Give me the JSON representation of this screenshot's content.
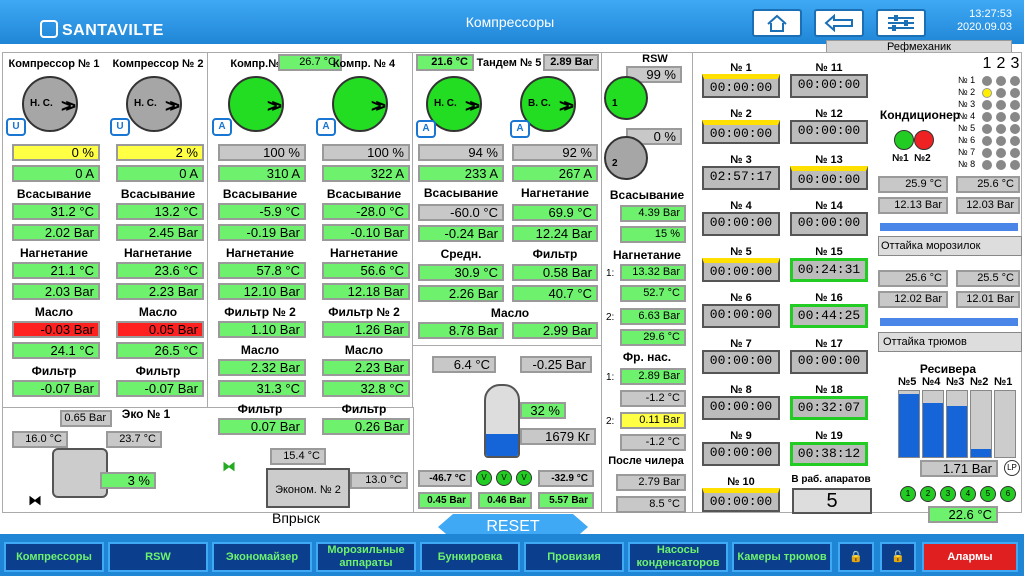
{
  "header": {
    "brand": "SANTAVILTE",
    "title": "Компрессоры",
    "time": "13:27:53",
    "date": "2020.09.03",
    "role": "Рефмеханик"
  },
  "compressors": [
    {
      "title": "Компрессор № 1",
      "mode": "Н. С.",
      "pct": "0 %",
      "amp": "0 A",
      "suction": "Всасывание",
      "s_temp": "31.2 °C",
      "s_bar": "2.02 Bar",
      "disch": "Нагнетание",
      "d_temp": "21.1 °C",
      "d_bar": "2.03 Bar",
      "oil": "Масло",
      "oil_bar": "-0.03 Bar",
      "oil_temp": "24.1 °C",
      "filter": "Фильтр",
      "f_bar": "-0.07 Bar"
    },
    {
      "title": "Компрессор № 2",
      "mode": "Н. С.",
      "pct": "2 %",
      "amp": "0 A",
      "suction": "Всасывание",
      "s_temp": "13.2 °C",
      "s_bar": "2.45 Bar",
      "disch": "Нагнетание",
      "d_temp": "23.6 °C",
      "d_bar": "2.23 Bar",
      "oil": "Масло",
      "oil_bar": "0.05 Bar",
      "oil_temp": "26.5 °C",
      "filter": "Фильтр",
      "f_bar": "-0.07 Bar"
    },
    {
      "title": "Компр.№ 3",
      "top": "26.7 °C",
      "pct": "100 %",
      "amp": "310 A",
      "suction": "Всасывание",
      "s_temp": "-5.9 °C",
      "s_bar": "-0.19 Bar",
      "disch": "Нагнетание",
      "d_temp": "57.8 °C",
      "d_bar": "12.10 Bar",
      "f2": "Фильтр № 2",
      "f2_bar": "1.10 Bar",
      "oil": "Масло",
      "oil_bar": "2.32 Bar",
      "oil_temp": "31.3 °C",
      "filter": "Фильтр",
      "f_bar": "0.07 Bar"
    },
    {
      "title": "Компр. № 4",
      "pct": "100 %",
      "amp": "322 A",
      "suction": "Всасывание",
      "s_temp": "-28.0 °C",
      "s_bar": "-0.10 Bar",
      "disch": "Нагнетание",
      "d_temp": "56.6 °C",
      "d_bar": "12.18 Bar",
      "f2": "Фильтр № 2",
      "f2_bar": "1.26 Bar",
      "oil": "Масло",
      "oil_bar": "2.23 Bar",
      "oil_temp": "32.8 °C",
      "filter": "Фильтр",
      "f_bar": "0.26 Bar"
    }
  ],
  "tandem": {
    "top_temp": "21.6 °C",
    "title": "Тандем № 5",
    "top_bar": "2.89 Bar",
    "mode_a": "Н. С.",
    "mode_b": "В. С.",
    "pct_a": "94 %",
    "pct_b": "92 %",
    "amp_a": "233 A",
    "amp_b": "267 A",
    "suction": "Всасывание",
    "disch": "Нагнетание",
    "s_temp": "-60.0 °C",
    "d_temp": "69.9 °C",
    "s_bar": "-0.24 Bar",
    "d_bar": "12.24 Bar",
    "mid": "Средн.",
    "filt": "Фильтр",
    "mid_temp": "30.9 °C",
    "filt_bar": "0.58 Bar",
    "mid_bar": "2.26 Bar",
    "filt_temp": "40.7 °C",
    "oil": "Масло",
    "oil_a": "8.78 Bar",
    "oil_b": "2.99 Bar"
  },
  "eco": {
    "title": "Эко № 1",
    "p": "0.65 Bar",
    "t1": "16.0 °C",
    "t2": "23.7 °C",
    "pct": "3 %",
    "t3": "15.4 °C",
    "econ": "Эконом. № 2",
    "t4": "13.0 °C",
    "inj": "Впрыск"
  },
  "receiver": {
    "t": "6.4 °C",
    "p": "-0.25 Bar",
    "pct": "32 %",
    "kg": "1679 Кг",
    "a": "-46.7 °C",
    "b": "-32.9 °C",
    "c": "0.45 Bar",
    "d": "0.46 Bar",
    "e": "5.57 Bar"
  },
  "rsw": {
    "title": "RSW",
    "p1": "99 %",
    "p2": "0 %",
    "suction": "Всасывание",
    "s1": "4.39 Bar",
    "s2": "15 %",
    "disch": "Нагнетание",
    "n1a": "13.32 Bar",
    "n1b": "52.7 °C",
    "n2a": "6.63 Bar",
    "n2b": "29.6 °C",
    "fr": "Фр. нас.",
    "fr1a": "2.89 Bar",
    "fr1b": "-1.2 °C",
    "fr2a": "0.11 Bar",
    "fr2b": "-1.2 °C",
    "after": "После чилера",
    "a1": "2.79 Bar",
    "a2": "8.5 °C",
    "idx1": "1:",
    "idx2": "2:"
  },
  "timers": [
    {
      "n": "№ 1",
      "v": "00:00:00"
    },
    {
      "n": "№ 2",
      "v": "00:00:00"
    },
    {
      "n": "№ 3",
      "v": "02:57:17"
    },
    {
      "n": "№ 4",
      "v": "00:00:00"
    },
    {
      "n": "№ 5",
      "v": "00:00:00"
    },
    {
      "n": "№ 6",
      "v": "00:00:00"
    },
    {
      "n": "№ 7",
      "v": "00:00:00"
    },
    {
      "n": "№ 8",
      "v": "00:00:00"
    },
    {
      "n": "№ 9",
      "v": "00:00:00"
    },
    {
      "n": "№ 10",
      "v": "00:00:00"
    },
    {
      "n": "№ 11",
      "v": "00:00:00"
    },
    {
      "n": "№ 12",
      "v": "00:00:00"
    },
    {
      "n": "№ 13",
      "v": "00:00:00"
    },
    {
      "n": "№ 14",
      "v": "00:00:00"
    },
    {
      "n": "№ 15",
      "v": "00:24:31"
    },
    {
      "n": "№ 16",
      "v": "00:44:25"
    },
    {
      "n": "№ 17",
      "v": "00:00:00"
    },
    {
      "n": "№ 18",
      "v": "00:32:07"
    },
    {
      "n": "№ 19",
      "v": "00:38:12"
    }
  ],
  "inwork": {
    "label": "В раб. апаратов",
    "value": "5"
  },
  "ac": {
    "title": "Кондиционер",
    "n1": "№1",
    "n2": "№2",
    "t1": "25.9 °C",
    "t2": "25.6 °C",
    "b1": "12.13 Bar",
    "b2": "12.03 Bar",
    "defrost1": "Оттайка морозилок",
    "t3": "25.6 °C",
    "t4": "25.5 °C",
    "b3": "12.02 Bar",
    "b4": "12.01 Bar",
    "defrost2": "Оттайка трюмов"
  },
  "grid": {
    "cols": [
      "1",
      "2",
      "3"
    ],
    "rows": [
      "№ 1",
      "№ 2",
      "№ 3",
      "№ 4",
      "№ 5",
      "№ 6",
      "№ 7",
      "№ 8"
    ]
  },
  "receivers": {
    "title": "Ресивера",
    "labels": [
      "№5",
      "№4",
      "№3",
      "№2",
      "№1"
    ],
    "levels": [
      0.95,
      0.82,
      0.78,
      0.12,
      0.0
    ],
    "pressure": "1.71 Bar",
    "lp": "LP",
    "temp": "22.6 °C",
    "circles": [
      "1",
      "2",
      "3",
      "4",
      "5",
      "6"
    ]
  },
  "reset": "RESET",
  "bottom": [
    "Компрессоры",
    "RSW",
    "Экономайзер",
    "Морозильные аппараты",
    "Бункировка",
    "Провизия",
    "Насосы конденсаторов",
    "Камеры трюмов"
  ],
  "alarms": "Алармы"
}
